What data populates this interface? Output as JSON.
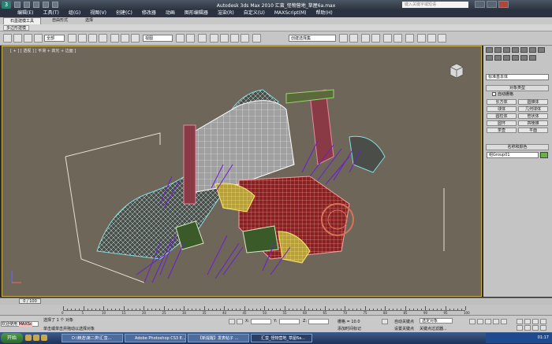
{
  "window": {
    "title": "Autodesk 3ds Max 2010    汇蛮_怪物营地_草屋6a.max",
    "search_placeholder": "键入关键字或短语"
  },
  "menu": [
    "编辑(E)",
    "工具(T)",
    "组(G)",
    "视图(V)",
    "创建(C)",
    "修改器",
    "动画",
    "图形编辑器",
    "渲染(R)",
    "自定义(U)",
    "MAXScript(M)",
    "帮助(H)"
  ],
  "ribbon": {
    "tabs": [
      "石墨建模工具",
      "自由形式",
      "选择"
    ],
    "poly_label": "多边形建模"
  },
  "toolbar": {
    "selection_filter": "全部",
    "ref_coord": "视图",
    "named_selection": "创建选择集"
  },
  "viewport": {
    "label": "[ + ] [ 透视 ] [ 平滑 + 高光 + 边面 ]",
    "bg_color": "#6e6658",
    "frame_color": "#c9b24b"
  },
  "command_panel": {
    "category": "标准基本体",
    "object_type_header": "对象类型",
    "autogrid": "自动栅格",
    "objects": [
      "长方体",
      "圆锥体",
      "球体",
      "几何球体",
      "圆柱体",
      "管状体",
      "圆环",
      "四棱锥",
      "茶壶",
      "平面"
    ],
    "name_color_header": "名称和颜色",
    "object_name": "组Group01",
    "object_color": "#66b244"
  },
  "timeline": {
    "frame_display": "0 / 100",
    "ticks": [
      "0",
      "5",
      "10",
      "15",
      "20",
      "25",
      "30",
      "35",
      "40",
      "45",
      "50",
      "55",
      "60",
      "65",
      "70",
      "75",
      "80",
      "85",
      "90",
      "95",
      "100"
    ]
  },
  "status": {
    "maxscript_label": "欢迎使用",
    "maxscript_text": "MAXSc",
    "selected": "选择了 1 个 对象",
    "prompt": "单击或单击并拖动以选择对象",
    "x_label": "X:",
    "x_value": "",
    "y_label": "Y:",
    "y_value": "",
    "z_label": "Z:",
    "z_value": "",
    "grid": "栅格 = 10.0",
    "add_time_tag": "添加时间标记",
    "auto_key": "自动关键点",
    "set_key": "设置关键点",
    "selected_filter": "选定对象",
    "key_filters": "关键点过滤器..."
  },
  "taskbar": {
    "start": "开始",
    "tasks": [
      "D:\\精选\\第二类\\汇蛮...",
      "Adobe Photoshop CS3 E...",
      "【新提醒】发表帖子 ...",
      "汇蛮_怪物营地_草屋6a..."
    ],
    "time": "01:17"
  }
}
